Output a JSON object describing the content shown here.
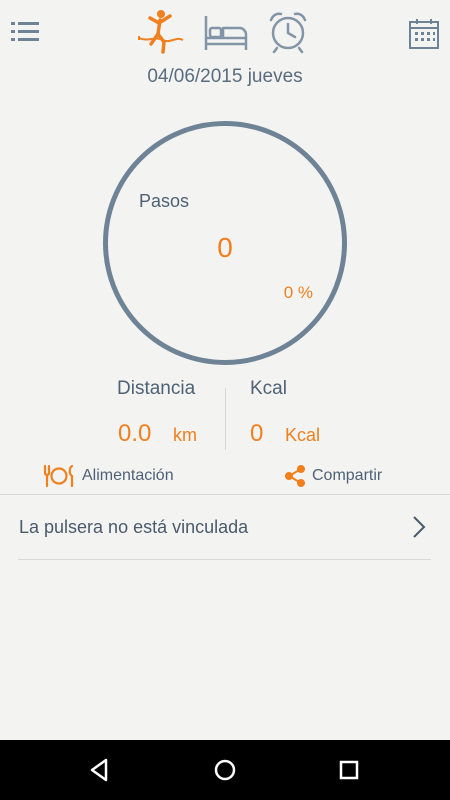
{
  "header": {
    "menu_icon": "list-menu-icon",
    "tabs": [
      {
        "icon": "activity-runner-icon",
        "active": true
      },
      {
        "icon": "sleep-bed-icon",
        "active": false
      },
      {
        "icon": "alarm-clock-icon",
        "active": false
      }
    ],
    "calendar_icon": "calendar-icon",
    "date": "04/06/2015 jueves"
  },
  "steps": {
    "label": "Pasos",
    "value": "0",
    "percent": "0 %",
    "progress": 0
  },
  "stats": {
    "distance": {
      "label": "Distancia",
      "value": "0.0",
      "unit": "km"
    },
    "kcal": {
      "label": "Kcal",
      "value": "0",
      "unit": "Kcal"
    }
  },
  "actions": {
    "food": {
      "label": "Alimentación",
      "icon": "fork-plate-knife-icon"
    },
    "share": {
      "label": "Compartir",
      "icon": "share-icon"
    }
  },
  "device_row": {
    "label": "La pulsera no está vinculada",
    "icon": "chevron-right-icon"
  },
  "navbar": {
    "back_icon": "back-triangle-icon",
    "home_icon": "home-circle-icon",
    "recents_icon": "recents-square-icon"
  },
  "colors": {
    "accent": "#f07f1e",
    "slate": "#6f8396",
    "background": "#f3f3f2"
  }
}
